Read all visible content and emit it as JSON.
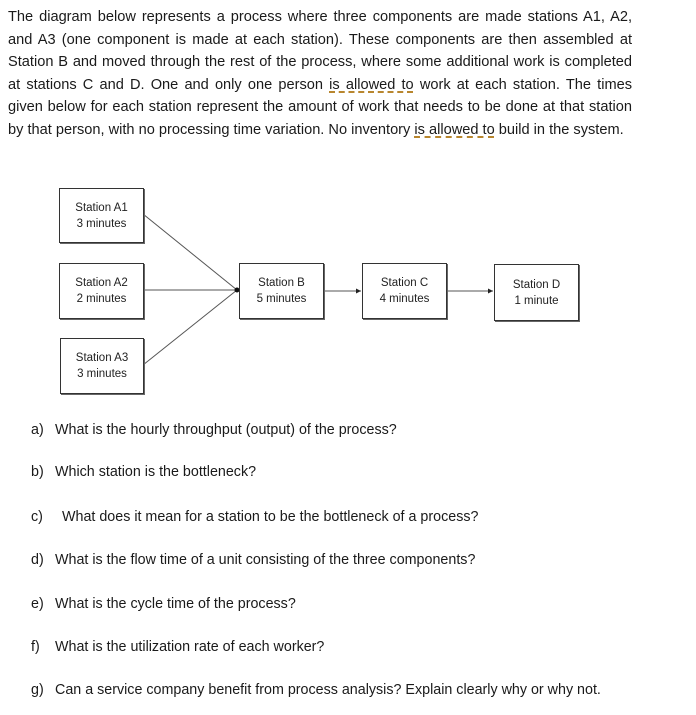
{
  "intro": {
    "parts": [
      "The diagram below represents a process where three components are made stations A1, A2, and A3 (one component is made at each station). These components are then assembled at Station B and moved through the rest of the process, where some additional work is completed at stations C and D.  One and only one person ",
      "is allowed to",
      " work at each station. The times given below for each station represent the amount of work that needs to be done at that station by that person, with no processing time variation. No inventory ",
      "is allowed to",
      " build in the system."
    ]
  },
  "diagram": {
    "stations": [
      {
        "id": "A1",
        "name": "Station A1",
        "time": "3 minutes"
      },
      {
        "id": "A2",
        "name": "Station A2",
        "time": "2 minutes"
      },
      {
        "id": "A3",
        "name": "Station A3",
        "time": "3 minutes"
      },
      {
        "id": "B",
        "name": "Station B",
        "time": "5 minutes"
      },
      {
        "id": "C",
        "name": "Station C",
        "time": "4 minutes"
      },
      {
        "id": "D",
        "name": "Station D",
        "time": "1 minute"
      }
    ],
    "flows": [
      [
        "A1",
        "B"
      ],
      [
        "A2",
        "B"
      ],
      [
        "A3",
        "B"
      ],
      [
        "B",
        "C"
      ],
      [
        "C",
        "D"
      ]
    ]
  },
  "questions": [
    {
      "label": "a)",
      "text": "What is the hourly throughput (output) of the process?"
    },
    {
      "label": "b)",
      "text": "Which station is the bottleneck?"
    },
    {
      "label": "c)",
      "text": "What does it mean for a station to be the bottleneck of a process?"
    },
    {
      "label": "d)",
      "text": "What is the flow time of a unit consisting of the three components?"
    },
    {
      "label": "e)",
      "text": "What is the cycle time of the process?"
    },
    {
      "label": "f)",
      "text": "What is the utilization rate of each worker?"
    },
    {
      "label": "g)",
      "text": "Can a service company benefit from process analysis? Explain clearly why or why not."
    }
  ],
  "colors": {
    "grammar_underline": "#b8862e",
    "text": "#1a1a1a",
    "box_border": "#333333"
  }
}
